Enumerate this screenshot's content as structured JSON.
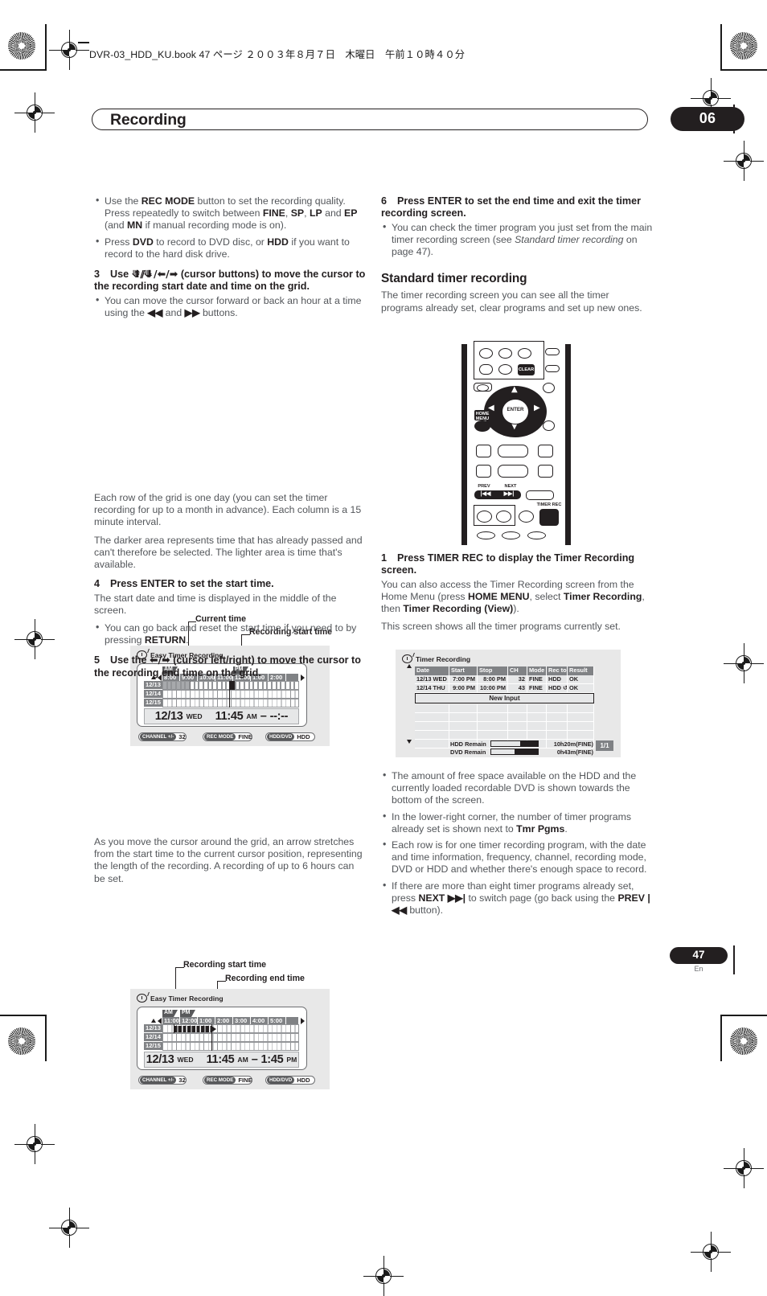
{
  "header": {
    "book_line": "DVR-03_HDD_KU.book  47 ページ  ２００３年８月７日　木曜日　午前１０時４０分"
  },
  "title_bar": {
    "title": "Recording",
    "chapter": "06"
  },
  "footer": {
    "page_number": "47",
    "language": "En"
  },
  "left_column": {
    "bullets_top": [
      "Use the REC MODE button to set the recording quality. Press repeatedly to switch between FINE, SP, LP and EP (and MN if manual recording mode is on).",
      "Press DVD to record to DVD disc, or HDD if you want to record to the hard disk drive."
    ],
    "step3": {
      "number": "3",
      "heading": "Use ↑/↓/←/→ (cursor buttons) to move the cursor to the recording start date and time on the grid.",
      "bullet": "You can move the cursor forward or back an hour at a time using the ◄◄ and ►► buttons."
    },
    "figure1": {
      "callout_current_time": "Current time",
      "callout_recording_start": "Recording start time"
    },
    "paragraphs_mid": [
      "Each row of the grid is one day (you can set the timer recording for up to a month in advance). Each column is a 15 minute interval.",
      "The darker area represents time that has already passed and can't therefore be selected. The lighter area is time that's available."
    ],
    "step4": {
      "number": "4",
      "heading": "Press ENTER to set the start time.",
      "paragraph": "The start date and time is displayed in the middle of the screen.",
      "bullet": "You can go back and reset the start time if you need to by pressing RETURN."
    },
    "step5": {
      "number": "5",
      "heading": "Use the ←/→ (cursor left/right) to move the cursor to the recording end time on the grid."
    },
    "figure2": {
      "callout_recording_start": "Recording start time",
      "callout_recording_end": "Recording end time"
    },
    "paragraph_bottom": "As you move the cursor around the grid, an arrow stretches from the start time to the current cursor position, representing the length of the recording. A recording of up to 6 hours can be set."
  },
  "right_column": {
    "step6": {
      "number": "6",
      "heading": "Press ENTER to set the end time and exit the timer recording screen.",
      "bullet": "You can check the timer program you just set from the main timer recording screen (see Standard timer recording on page 47)."
    },
    "section": {
      "heading": "Standard timer recording",
      "paragraph": "The timer recording screen you can see all the timer programs already set, clear programs and set up new ones."
    },
    "step1": {
      "number": "1",
      "heading": "Press TIMER REC to display the Timer Recording screen.",
      "paragraph": "You can also access the Timer Recording screen from the Home Menu (press HOME MENU, select Timer Recording, then Timer Recording (View)).",
      "paragraph2": "This screen shows all the timer programs currently set."
    },
    "bullets_bottom": [
      "The amount of free space available on the HDD and the currently loaded recordable DVD is shown towards the bottom of the screen.",
      "In the lower-right corner, the number of timer programs already set is shown next to Tmr Pgms.",
      "Each row is for one timer recording program, with the date and time information, frequency, channel, recording mode, DVD or HDD and whether there's enough space to record.",
      "If there are more than eight timer programs already set, press NEXT ►►| to switch page (go back using the PREV |◄◄ button)."
    ]
  },
  "easy_timer_screen_1": {
    "screen_title": "Easy Timer Recording",
    "ampm_labels": [
      "AM",
      "PM"
    ],
    "time_headers": [
      "8:00",
      "9:00",
      "10:00",
      "11:00",
      "12:00",
      "1:00",
      "2:00"
    ],
    "day_rows": [
      "12/13",
      "12/14",
      "12/15"
    ],
    "display": {
      "date": "12/13",
      "weekday": "WED",
      "start_time": "11:45",
      "start_ampm": "AM",
      "separator": "–",
      "end_time": "--:--"
    },
    "footer_pills": [
      {
        "key": "CHANNEL +/-",
        "value": "32"
      },
      {
        "key": "REC MODE",
        "value": "FINE"
      },
      {
        "key": "HDD/DVD",
        "value": "HDD"
      }
    ]
  },
  "easy_timer_screen_2": {
    "screen_title": "Easy Timer Recording",
    "ampm_labels": [
      "AM",
      "PM"
    ],
    "time_headers": [
      "11:00",
      "12:00",
      "1:00",
      "2:00",
      "3:00",
      "4:00",
      "5:00"
    ],
    "day_rows": [
      "12/13",
      "12/14",
      "12/15"
    ],
    "display": {
      "date": "12/13",
      "weekday": "WED",
      "start_time": "11:45",
      "start_ampm": "AM",
      "separator": "–",
      "end_time": "1:45",
      "end_ampm": "PM"
    },
    "footer_pills": [
      {
        "key": "CHANNEL +/-",
        "value": "32"
      },
      {
        "key": "REC MODE",
        "value": "FINE"
      },
      {
        "key": "HDD/DVD",
        "value": "HDD"
      }
    ]
  },
  "remote": {
    "labels": {
      "clear": "CLEAR",
      "enter": "ENTER",
      "home_menu": "HOME\nMENU",
      "prev": "PREV",
      "next": "NEXT",
      "prev_glyph": "◀◀",
      "next_glyph": "▶▶",
      "timer_rec": "TIMER REC"
    }
  },
  "timer_recording_screen": {
    "screen_title": "Timer Recording",
    "columns": [
      "Date",
      "Start",
      "Stop",
      "CH",
      "Mode",
      "Rec to",
      "Result"
    ],
    "rows": [
      {
        "date": "12/13 WED",
        "start": "7:00 PM",
        "stop": "8:00 PM",
        "ch": "32",
        "mode": "FINE",
        "rec_to": "HDD",
        "result": "OK"
      },
      {
        "date": "12/14 THU",
        "start": "9:00 PM",
        "stop": "10:00 PM",
        "ch": "43",
        "mode": "FINE",
        "rec_to": "HDD ↺",
        "result": "OK"
      }
    ],
    "new_input_label": "New Input",
    "meters": [
      {
        "label": "HDD Remain",
        "value": "10h20m(FINE)",
        "percent": 63
      },
      {
        "label": "DVD Remain",
        "value": "0h43m(FINE)",
        "percent": 52
      }
    ],
    "page_indicator": "1/1"
  }
}
